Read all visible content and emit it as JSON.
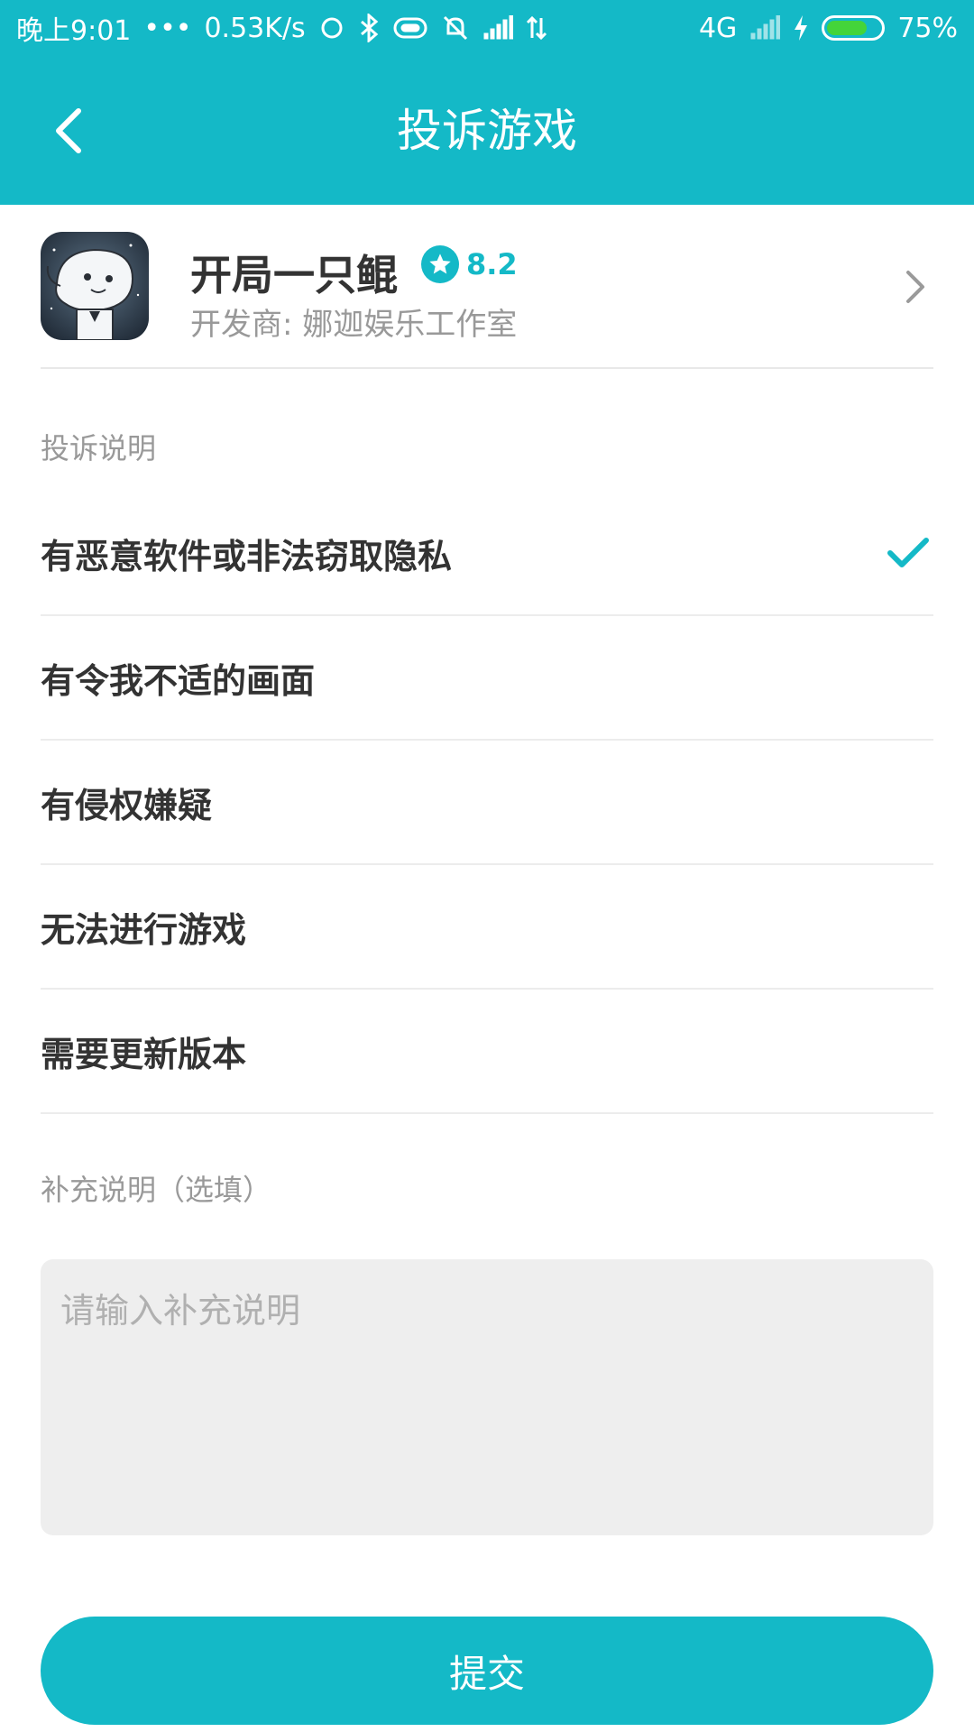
{
  "status_bar": {
    "time": "晚上9:01",
    "dots": "•••",
    "net_speed": "0.53K/s",
    "network": "4G",
    "battery": "75%",
    "battery_level": 0.75,
    "battery_color": "#44d43a"
  },
  "header": {
    "title": "投诉游戏",
    "back_icon": "chevron-left-icon",
    "background": "#14b9c7"
  },
  "game": {
    "name": "开局一只鲲",
    "rating": "8.2",
    "developer": "开发商: 娜迦娱乐工作室"
  },
  "complaint": {
    "section_label": "投诉说明",
    "options": [
      {
        "label": "有恶意软件或非法窃取隐私",
        "selected": true
      },
      {
        "label": "有令我不适的画面",
        "selected": false
      },
      {
        "label": "有侵权嫌疑",
        "selected": false
      },
      {
        "label": "无法进行游戏",
        "selected": false
      },
      {
        "label": "需要更新版本",
        "selected": false
      }
    ]
  },
  "supplement": {
    "section_label": "补充说明（选填）",
    "placeholder": "请输入补充说明"
  },
  "submit_label": "提交",
  "accent_color": "#14b9c7"
}
